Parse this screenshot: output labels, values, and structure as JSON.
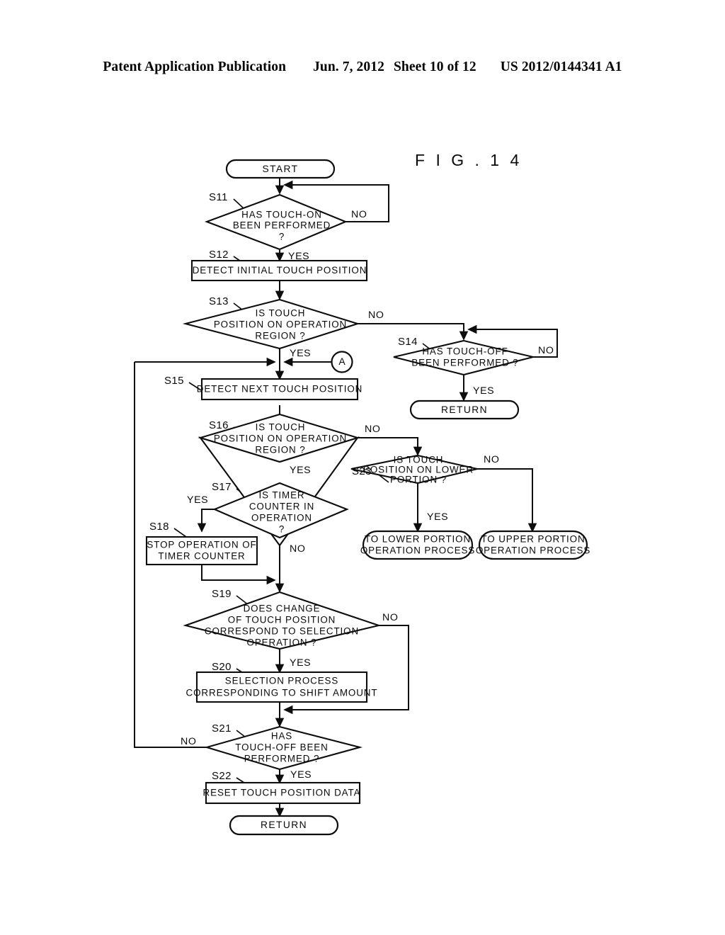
{
  "header": {
    "publication": "Patent Application Publication",
    "date": "Jun. 7, 2012",
    "sheet": "Sheet 10 of 12",
    "patent_number": "US 2012/0144341 A1"
  },
  "figure": {
    "title": "F I G .   1 4"
  },
  "nodes": {
    "start": "START",
    "s11": "HAS TOUCH-ON|BEEN PERFORMED|?",
    "s12": "DETECT INITIAL TOUCH POSITION",
    "s13": "IS TOUCH|POSITION ON OPERATION|REGION ?",
    "s14": "HAS TOUCH-OFF|BEEN PERFORMED ?",
    "return_s14": "RETURN",
    "connector_a": "A",
    "s15": "DETECT NEXT TOUCH POSITION",
    "s16": "IS TOUCH|POSITION ON OPERATION|REGION ?",
    "s17": "IS TIMER|COUNTER IN|OPERATION|?",
    "s18": "STOP OPERATION OF|TIMER COUNTER",
    "s19": "DOES CHANGE|OF TOUCH POSITION|CORRESPOND TO SELECTION|OPERATION ?",
    "s20": "SELECTION PROCESS|CORRESPONDING TO SHIFT AMOUNT",
    "s21": "HAS|TOUCH-OFF BEEN|PERFORMED ?",
    "s22": "RESET TOUCH POSITION DATA",
    "return_s22": "RETURN",
    "s23": "IS TOUCH|POSITION ON LOWER|PORTION ?",
    "to_lower": "TO LOWER PORTION|OPERATION PROCESS",
    "to_upper": "TO UPPER PORTION|OPERATION PROCESS"
  },
  "step_labels": {
    "s11": "S11",
    "s12": "S12",
    "s13": "S13",
    "s14": "S14",
    "s15": "S15",
    "s16": "S16",
    "s17": "S17",
    "s18": "S18",
    "s19": "S19",
    "s20": "S20",
    "s21": "S21",
    "s22": "S22",
    "s23": "S23"
  },
  "branch_labels": {
    "s11_no": "NO",
    "s11_yes": "YES",
    "s13_no": "NO",
    "s13_yes": "YES",
    "s14_no": "NO",
    "s14_yes": "YES",
    "s16_no": "NO",
    "s16_yes": "YES",
    "s17_yes": "YES",
    "s17_no": "NO",
    "s19_no": "NO",
    "s19_yes": "YES",
    "s21_no": "NO",
    "s21_yes": "YES",
    "s23_no": "NO",
    "s23_yes": "YES"
  },
  "colors": {
    "ink": "#0d0d0d",
    "paper": "#ffffff"
  }
}
